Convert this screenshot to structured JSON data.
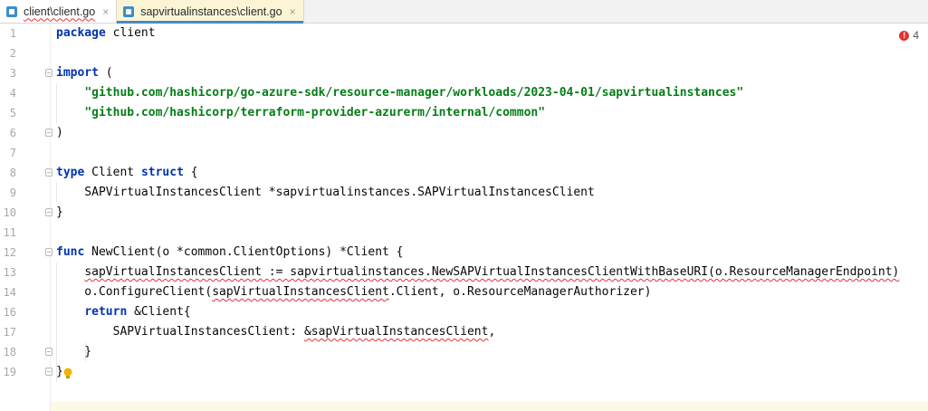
{
  "tabs": [
    {
      "label": "client\\client.go",
      "icon": "go-file-icon",
      "close": "×",
      "state": "inactive"
    },
    {
      "label": "sapvirtualinstances\\client.go",
      "icon": "go-file-icon",
      "close": "×",
      "state": "active"
    }
  ],
  "error_count": "4",
  "lines": [
    {
      "n": "1",
      "parts": [
        {
          "t": "package",
          "c": "kw"
        },
        {
          "t": " client",
          "c": ""
        }
      ]
    },
    {
      "n": "2",
      "parts": []
    },
    {
      "n": "3",
      "parts": [
        {
          "t": "import",
          "c": "kw"
        },
        {
          "t": " (",
          "c": ""
        }
      ]
    },
    {
      "n": "4",
      "parts": [
        {
          "t": "    ",
          "c": ""
        },
        {
          "t": "\"github.com/hashicorp/go-azure-sdk/resource-manager/workloads/2023-04-01/sapvirtualinstances\"",
          "c": "str"
        }
      ]
    },
    {
      "n": "5",
      "parts": [
        {
          "t": "    ",
          "c": ""
        },
        {
          "t": "\"github.com/hashicorp/terraform-provider-azurerm/internal/common\"",
          "c": "str"
        }
      ]
    },
    {
      "n": "6",
      "parts": [
        {
          "t": ")",
          "c": ""
        }
      ]
    },
    {
      "n": "7",
      "parts": []
    },
    {
      "n": "8",
      "parts": [
        {
          "t": "type",
          "c": "kw"
        },
        {
          "t": " Client ",
          "c": ""
        },
        {
          "t": "struct",
          "c": "kw"
        },
        {
          "t": " {",
          "c": ""
        }
      ]
    },
    {
      "n": "9",
      "parts": [
        {
          "t": "    SAPVirtualInstancesClient *sapvirtualinstances.SAPVirtualInstancesClient",
          "c": ""
        }
      ]
    },
    {
      "n": "10",
      "parts": [
        {
          "t": "}",
          "c": ""
        }
      ]
    },
    {
      "n": "11",
      "parts": []
    },
    {
      "n": "12",
      "parts": [
        {
          "t": "func",
          "c": "kw"
        },
        {
          "t": " NewClient(o *common.ClientOptions) *Client {",
          "c": ""
        }
      ]
    },
    {
      "n": "13",
      "parts": [
        {
          "t": "    ",
          "c": ""
        },
        {
          "t": "sapVirtualInstancesClient := sapvirtualinstances.NewSAPVirtualInstancesClientWithBaseURI(o.ResourceManagerEndpoint)",
          "c": "wavy"
        }
      ]
    },
    {
      "n": "14",
      "parts": [
        {
          "t": "    o.ConfigureClient(",
          "c": ""
        },
        {
          "t": "sapVirtualInstancesClient",
          "c": "wavy"
        },
        {
          "t": ".Client, o.ResourceManagerAuthorizer)",
          "c": ""
        }
      ]
    },
    {
      "n": "16",
      "parts": [
        {
          "t": "    ",
          "c": ""
        },
        {
          "t": "return",
          "c": "kw"
        },
        {
          "t": " &Client{",
          "c": ""
        }
      ]
    },
    {
      "n": "17",
      "parts": [
        {
          "t": "        SAPVirtualInstancesClient: ",
          "c": ""
        },
        {
          "t": "&sapVirtualInstancesClient",
          "c": "wavy"
        },
        {
          "t": ",",
          "c": ""
        }
      ]
    },
    {
      "n": "18",
      "parts": [
        {
          "t": "    }",
          "c": ""
        }
      ]
    },
    {
      "n": "19",
      "parts": [
        {
          "t": "}",
          "c": ""
        }
      ]
    }
  ],
  "colors": {
    "keyword": "#0033b3",
    "string": "#067d17",
    "error": "#e03434",
    "tab_active": "#fbf5d6"
  }
}
